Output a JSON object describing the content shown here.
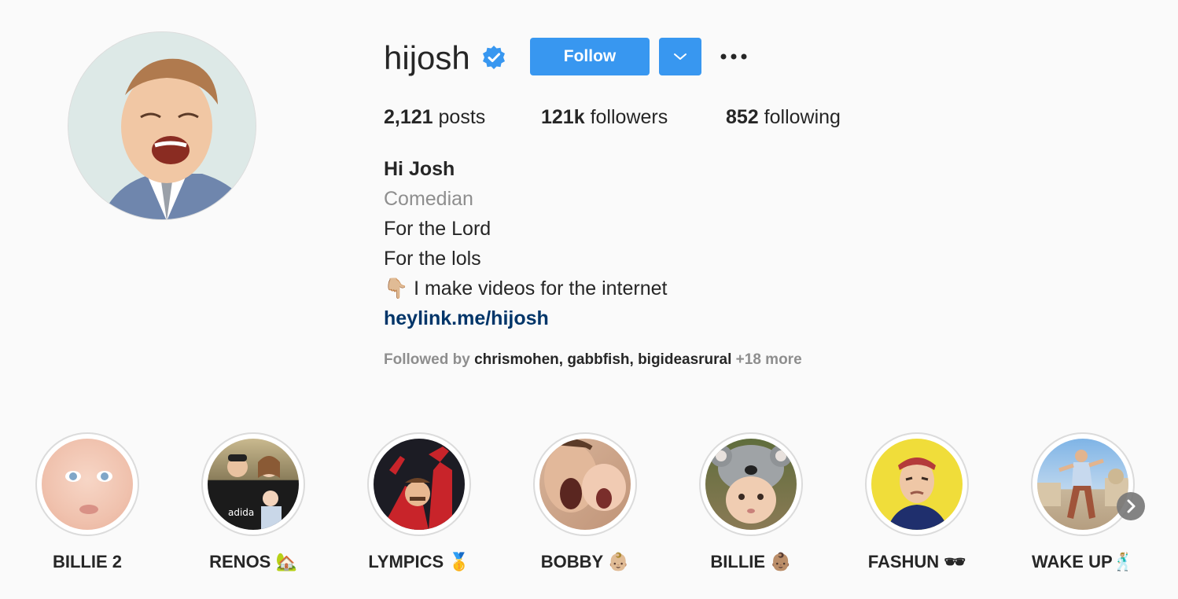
{
  "profile": {
    "username": "hijosh",
    "follow_label": "Follow",
    "stats": {
      "posts_count": "2,121",
      "posts_label": "posts",
      "followers_count": "121k",
      "followers_label": "followers",
      "following_count": "852",
      "following_label": "following"
    },
    "bio": {
      "name": "Hi Josh",
      "category": "Comedian",
      "line1": "For the Lord",
      "line2": "For the lols",
      "line3": "👇🏼 I make videos for the internet",
      "link": "heylink.me/hijosh"
    },
    "followed_by": {
      "prefix": "Followed by ",
      "users": [
        "chrismohen",
        "gabbfish",
        "bigideasrural"
      ],
      "more": "+18 more"
    }
  },
  "highlights": [
    {
      "label": "BILLIE 2"
    },
    {
      "label": "RENOS 🏡"
    },
    {
      "label": "LYMPICS 🥇"
    },
    {
      "label": "BOBBY 👶🏼"
    },
    {
      "label": "BILLIE 👶🏽"
    },
    {
      "label": "FASHUN 🕶"
    },
    {
      "label": "WAKE UP🕺🏼"
    }
  ],
  "colors": {
    "accent": "#3897f0",
    "link": "#003569",
    "muted": "#8e8e8e",
    "text": "#262626",
    "background": "#fafafa"
  },
  "icons": [
    "verified-badge-icon",
    "chevron-down-icon",
    "more-options-icon",
    "next-arrow-icon"
  ]
}
